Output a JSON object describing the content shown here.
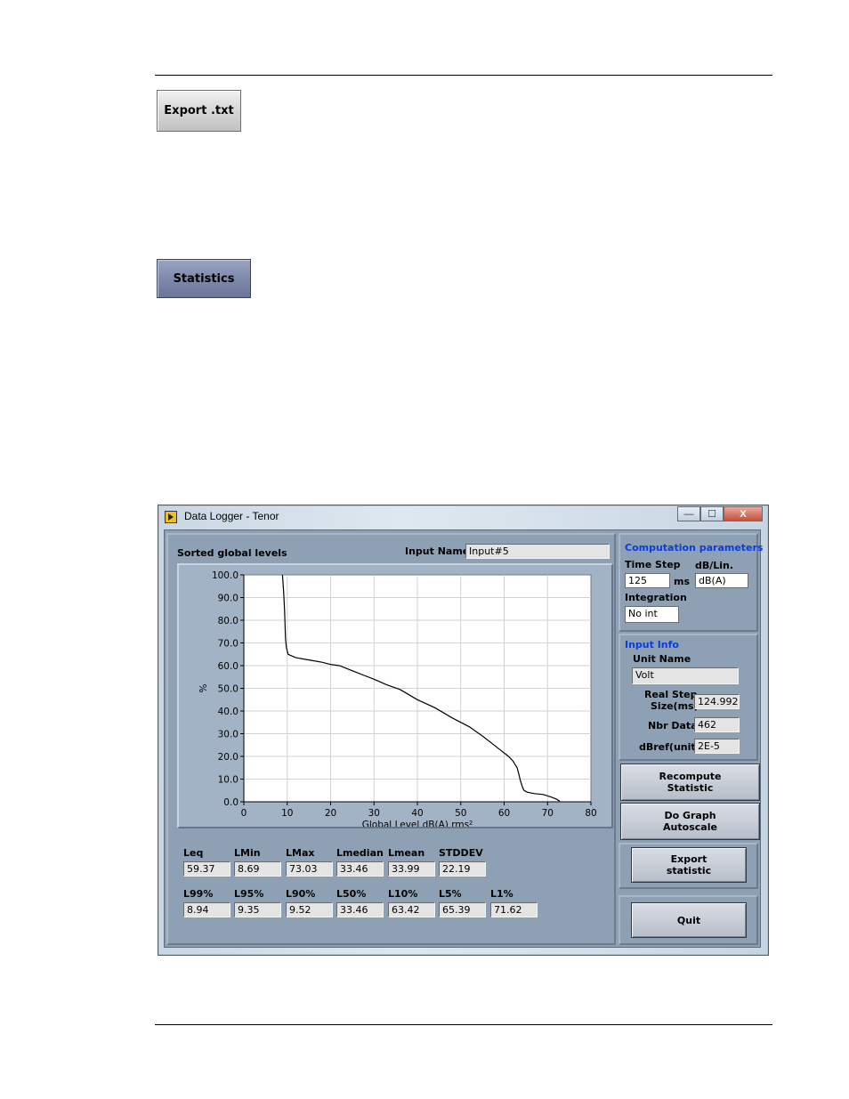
{
  "document": {
    "export_button_label": "Export .txt",
    "statistics_button_label": "Statistics"
  },
  "window": {
    "title": "Data Logger - Tenor",
    "controls": {
      "minimize": "—",
      "maximize": "☐",
      "close": "X"
    }
  },
  "graph": {
    "title": "Sorted global levels",
    "input_name_label": "Input Name",
    "input_name_value": "Input#5"
  },
  "chart_data": {
    "type": "line",
    "title": "Sorted global levels",
    "xlabel": "Global Level dB(A) rms²",
    "ylabel": "%",
    "xlim": [
      0,
      80
    ],
    "ylim": [
      0,
      100
    ],
    "x_ticks": [
      "0",
      "10",
      "20",
      "30",
      "40",
      "50",
      "60",
      "70",
      "80"
    ],
    "y_ticks": [
      "0.0",
      "10.0",
      "20.0",
      "30.0",
      "40.0",
      "50.0",
      "60.0",
      "70.0",
      "80.0",
      "90.0",
      "100.0"
    ],
    "grid": true,
    "legend": "none",
    "line_color": "#000000",
    "series": [
      {
        "x": [
          8.9,
          9.2,
          9.4,
          9.5,
          9.6,
          9.8,
          10.2,
          12,
          15,
          18,
          20,
          22,
          24,
          26,
          28,
          30,
          33,
          36,
          40,
          44,
          48,
          52,
          55,
          57,
          59,
          61,
          62,
          63,
          63.4,
          63.8,
          64.3,
          64.6,
          65.4,
          67,
          69,
          71,
          72,
          72.8
        ],
        "y": [
          100,
          92,
          84,
          78,
          72,
          68,
          65,
          63.5,
          62.5,
          61.5,
          60.5,
          60,
          58.5,
          57,
          55.5,
          54,
          51.5,
          49.5,
          45,
          41.5,
          37,
          33,
          29,
          26,
          23,
          20,
          18,
          15,
          12,
          9,
          6,
          5,
          4.2,
          3.6,
          3.2,
          2,
          1.2,
          0.3
        ]
      }
    ]
  },
  "stats": {
    "row1": [
      {
        "label": "Leq",
        "value": "59.37"
      },
      {
        "label": "LMin",
        "value": "8.69"
      },
      {
        "label": "LMax",
        "value": "73.03"
      },
      {
        "label": "Lmedian",
        "value": "33.46"
      },
      {
        "label": "Lmean",
        "value": "33.99"
      },
      {
        "label": "STDDEV",
        "value": "22.19"
      }
    ],
    "row2": [
      {
        "label": "L99%",
        "value": "8.94"
      },
      {
        "label": "L95%",
        "value": "9.35"
      },
      {
        "label": "L90%",
        "value": "9.52"
      },
      {
        "label": "L50%",
        "value": "33.46"
      },
      {
        "label": "L10%",
        "value": "63.42"
      },
      {
        "label": "L5%",
        "value": "65.39"
      },
      {
        "label": "L1%",
        "value": "71.62"
      }
    ]
  },
  "computation": {
    "title": "Computation parameters",
    "time_step_label": "Time Step",
    "time_step_value": "125",
    "time_step_unit": "ms",
    "db_lin_label": "dB/Lin.",
    "db_lin_value": "dB(A)",
    "integration_label": "Integration",
    "integration_value": "No int"
  },
  "input_info": {
    "title": "Input Info",
    "unit_name_label": "Unit Name",
    "unit_name_value": "Volt",
    "real_step_label_1": "Real Step",
    "real_step_label_2": "Size(ms)",
    "real_step_value": "124.992",
    "nbr_data_label": "Nbr Data",
    "nbr_data_value": "462",
    "dbref_label": "dBref(unit)",
    "dbref_value": "2E-5"
  },
  "buttons": {
    "recompute_1": "Recompute",
    "recompute_2": "Statistic",
    "autoscale_1": "Do Graph",
    "autoscale_2": "Autoscale",
    "export_1": "Export",
    "export_2": "statistic",
    "quit": "Quit"
  }
}
